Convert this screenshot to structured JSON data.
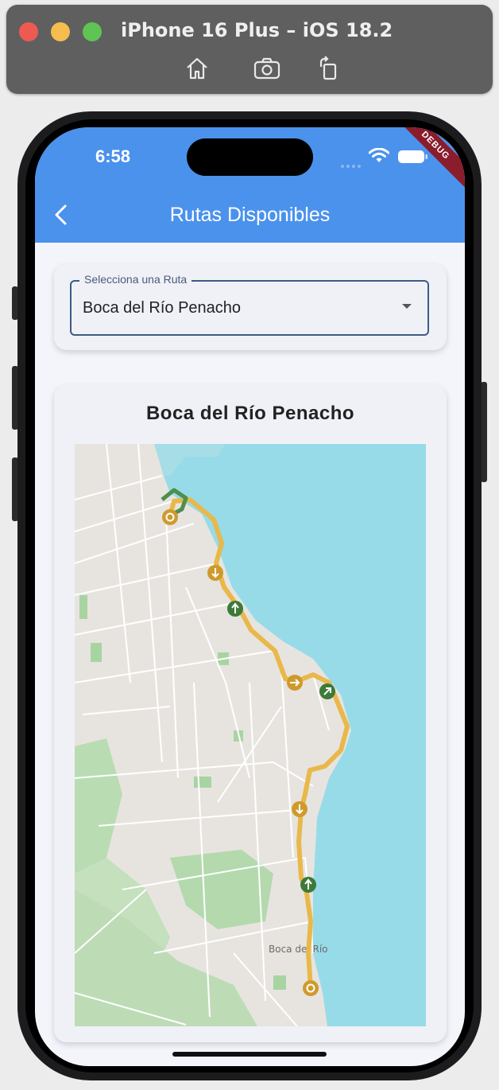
{
  "simulator": {
    "title": "iPhone 16 Plus – iOS 18.2",
    "tools": [
      "home-icon",
      "screenshot-icon",
      "rotate-icon"
    ]
  },
  "status_bar": {
    "time": "6:58",
    "debug_banner": "DEBUG"
  },
  "app_bar": {
    "title": "Rutas Disponibles",
    "back_icon": "chevron-left-icon"
  },
  "route_selector": {
    "label": "Selecciona una Ruta",
    "selected": "Boca del Río Penacho"
  },
  "route_card": {
    "title": "Boca del Río Penacho",
    "map": {
      "place_label": "Boca del Río",
      "route_color": "#e9b84a",
      "water_color": "#97dbe8",
      "land_color": "#e6e3df"
    }
  },
  "colors": {
    "app_bar": "#4a92ec",
    "background": "#f4f5fb",
    "card": "#f0f1f7"
  }
}
